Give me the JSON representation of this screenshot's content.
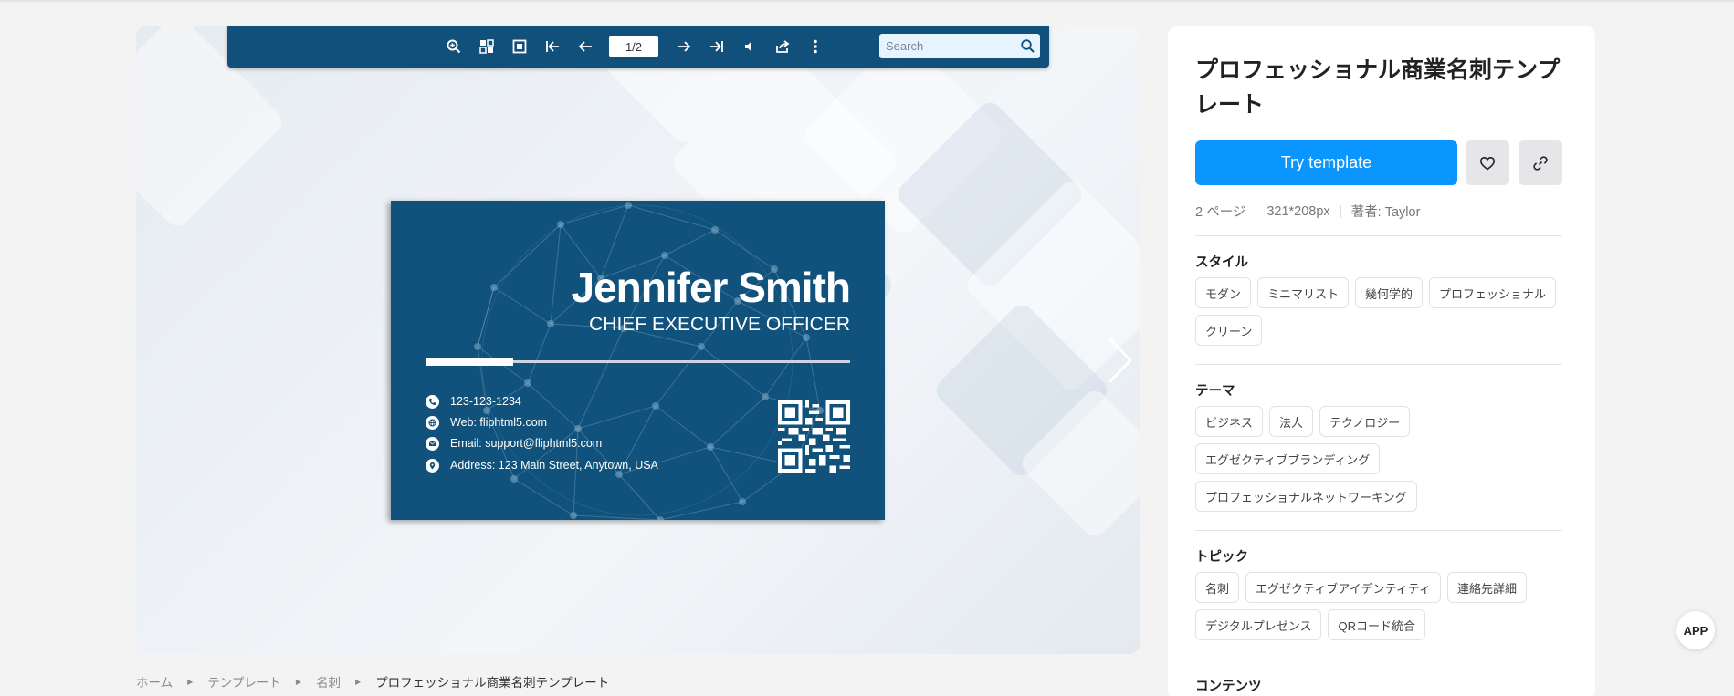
{
  "toolbar": {
    "page_value": "1/2",
    "search_placeholder": "Search"
  },
  "card": {
    "name": "Jennifer Smith",
    "title": "CHIEF EXECUTIVE OFFICER",
    "phone": "123-123-1234",
    "web": "Web: fliphtml5.com",
    "email": "Email: support@fliphtml5.com",
    "address": "Address:  123 Main Street, Anytown, USA",
    "bg_color": "#10527c"
  },
  "breadcrumb": {
    "home": "ホーム",
    "templates": "テンプレート",
    "category": "名刺",
    "current": "プロフェッショナル商業名刺テンプレート"
  },
  "panel": {
    "title": "プロフェッショナル商業名刺テンプレート",
    "try_button": "Try template",
    "pages": "2 ページ",
    "size": "321*208px",
    "author": "著者: Taylor",
    "sections": {
      "style": {
        "title": "スタイル",
        "tags": [
          "モダン",
          "ミニマリスト",
          "幾何学的",
          "プロフェッショナル",
          "クリーン"
        ]
      },
      "theme": {
        "title": "テーマ",
        "tags": [
          "ビジネス",
          "法人",
          "テクノロジー",
          "エグゼクティブブランディング",
          "プロフェッショナルネットワーキング"
        ]
      },
      "topic": {
        "title": "トピック",
        "tags": [
          "名刺",
          "エグゼクティブアイデンティティ",
          "連絡先詳細",
          "デジタルプレゼンス",
          "QRコード統合"
        ]
      },
      "contents": {
        "title": "コンテンツ"
      }
    }
  },
  "app_button": "APP",
  "colors": {
    "accent": "#0a95ff",
    "toolbar": "#11507a"
  }
}
